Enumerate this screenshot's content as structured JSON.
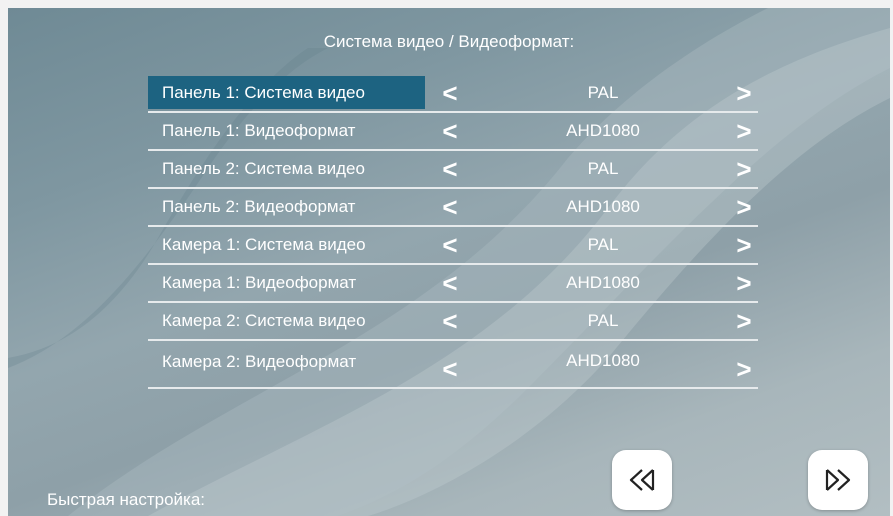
{
  "title": "Система видео / Видеоформат:",
  "rows": [
    {
      "label": "Панель 1: Система видео",
      "value": "PAL"
    },
    {
      "label": "Панель 1: Видеоформат",
      "value": "AHD1080"
    },
    {
      "label": "Панель 2: Система видео",
      "value": "PAL"
    },
    {
      "label": "Панель 2: Видеоформат",
      "value": "AHD1080"
    },
    {
      "label": "Камера 1: Система видео",
      "value": "PAL"
    },
    {
      "label": "Камера 1: Видеоформат",
      "value": "AHD1080"
    },
    {
      "label": "Камера 2: Система видео",
      "value": "PAL"
    },
    {
      "label": "Камера 2: Видеоформат",
      "value": "AHD1080"
    }
  ],
  "arrows": {
    "prev": "<",
    "next": ">"
  },
  "selected_row": "Панель 1: Система видео",
  "quick_setup_label": "Быстрая настройка:",
  "nav": {
    "back_icon": "double-left-triangle-icon",
    "forward_icon": "double-right-triangle-icon"
  },
  "colors": {
    "selection": "#1d6381",
    "text": "#ffffff",
    "button_bg": "#ffffff"
  }
}
